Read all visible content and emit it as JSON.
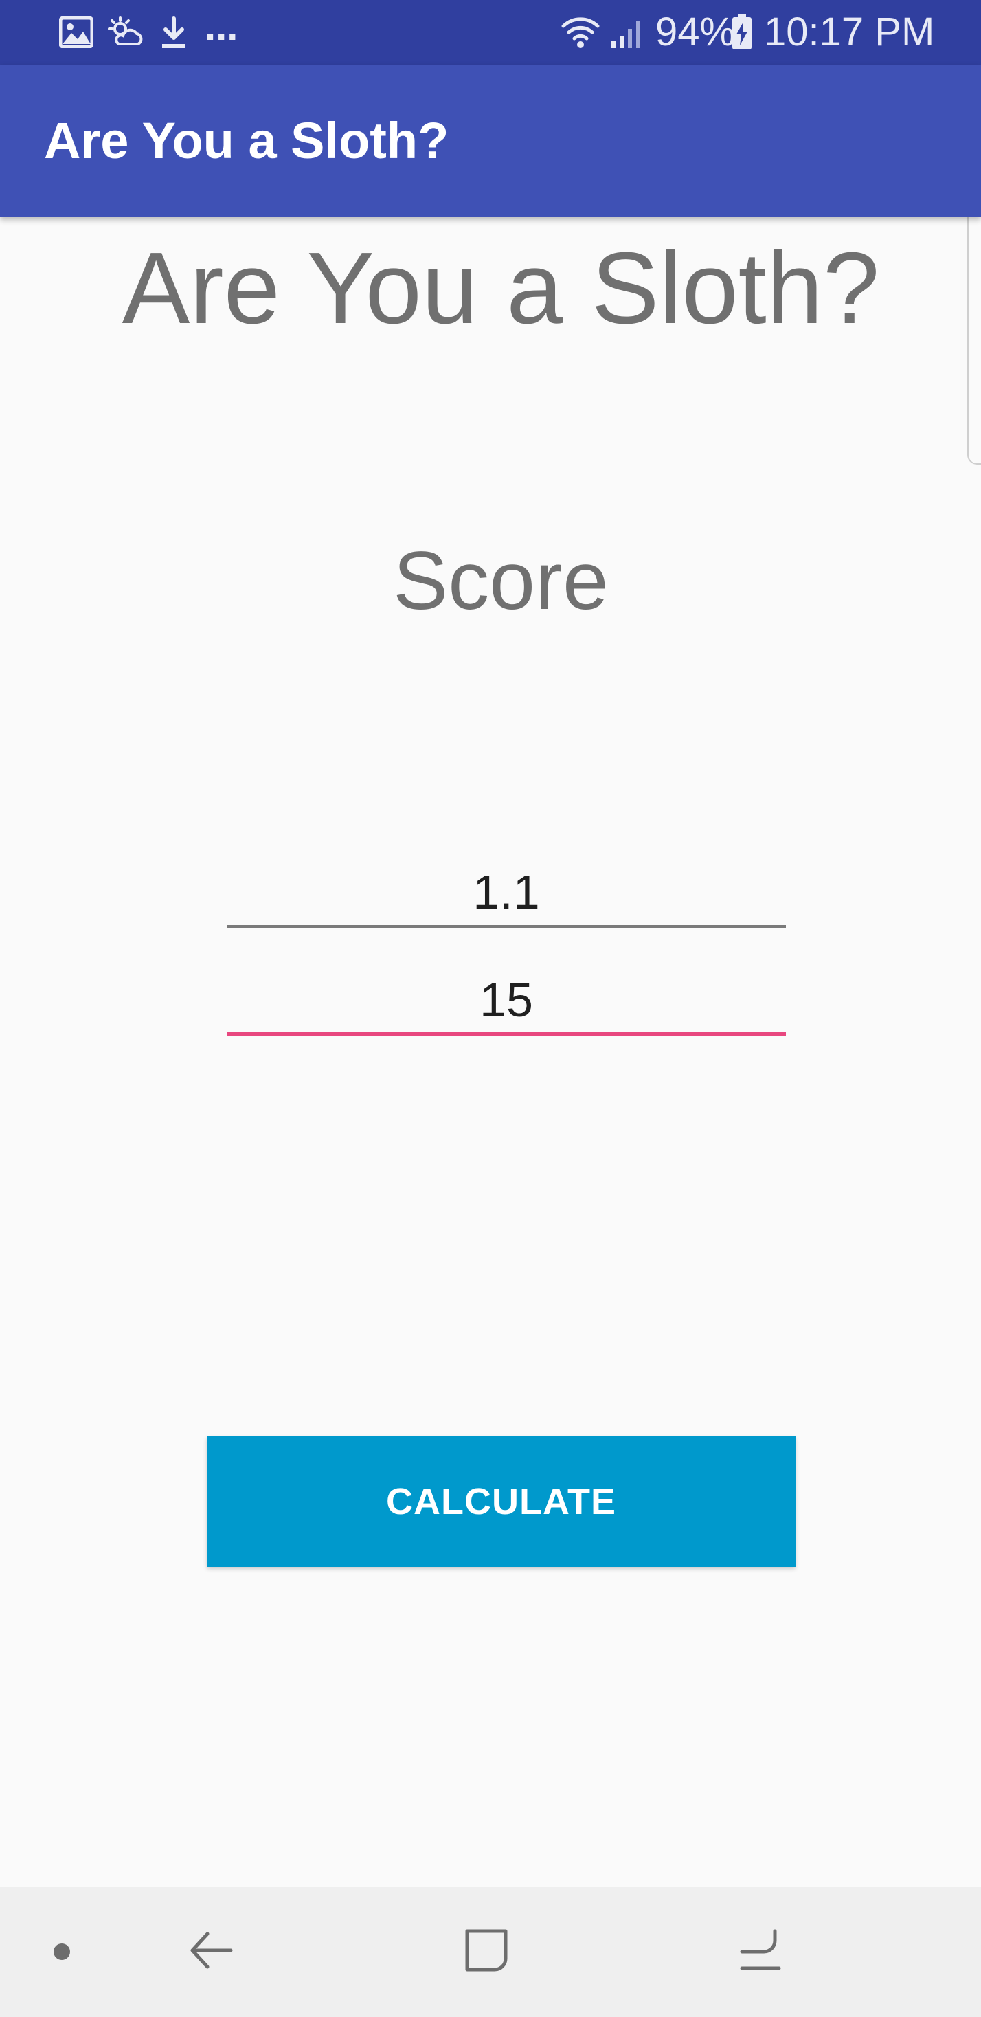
{
  "status_bar": {
    "left_icons": [
      "image-icon",
      "weather-icon",
      "download-icon"
    ],
    "overflow": "...",
    "right_icons": [
      "wifi-icon",
      "signal-icon"
    ],
    "battery": "94%",
    "battery_icon": "battery-charging-icon",
    "time": "10:17 PM"
  },
  "app_bar": {
    "title": "Are You a Sloth?"
  },
  "main": {
    "heading": "Are You a Sloth?",
    "score_label": "Score",
    "input_1": "1.1",
    "input_2": "15",
    "calculate_label": "CALCULATE"
  },
  "nav_bar": {
    "items": [
      "dot-icon",
      "back-icon",
      "home-icon",
      "recents-icon"
    ]
  },
  "colors": {
    "status_bar": "#303f9f",
    "app_bar": "#3f51b5",
    "button": "#0099cc",
    "focused_underline": "#e8477f"
  }
}
